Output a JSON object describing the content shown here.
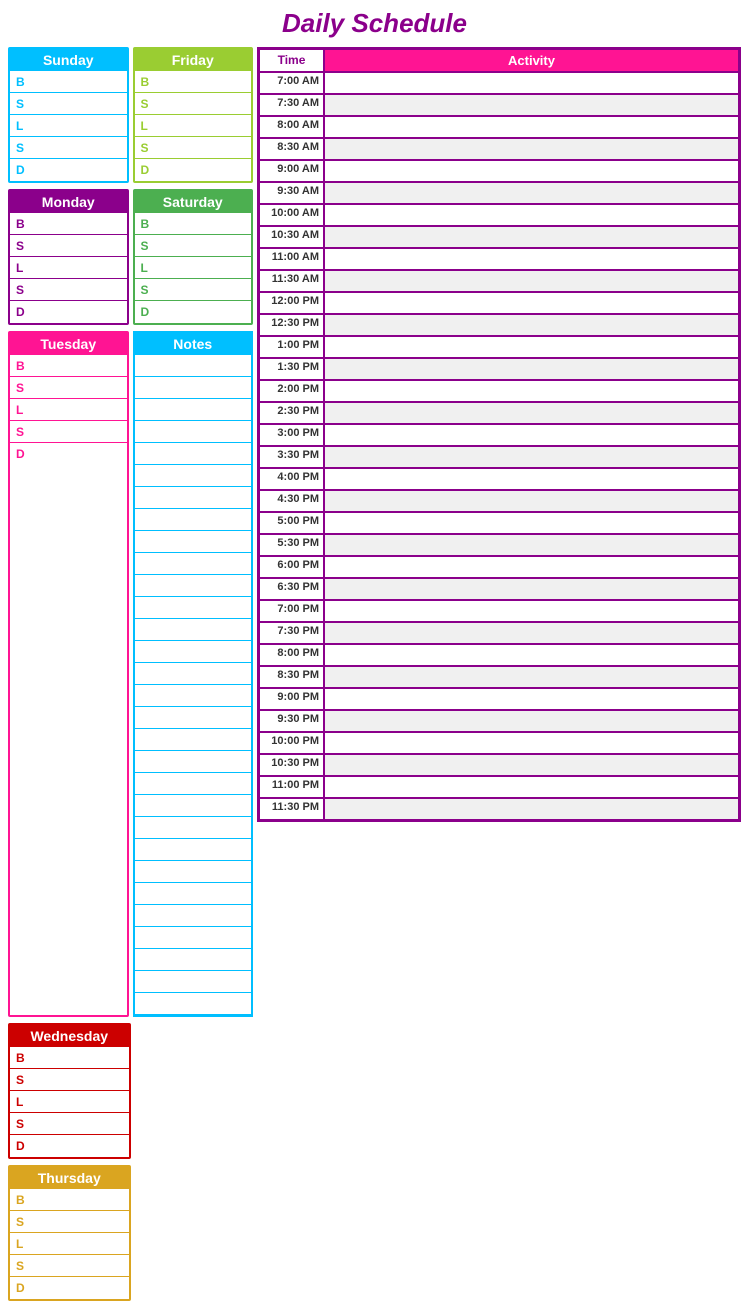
{
  "title": "Daily Schedule",
  "days": {
    "sunday": {
      "label": "Sunday",
      "class": "sunday",
      "meals": [
        "B",
        "S",
        "L",
        "S",
        "D"
      ]
    },
    "monday": {
      "label": "Monday",
      "class": "monday",
      "meals": [
        "B",
        "S",
        "L",
        "S",
        "D"
      ]
    },
    "tuesday": {
      "label": "Tuesday",
      "class": "tuesday",
      "meals": [
        "B",
        "S",
        "L",
        "S",
        "D"
      ]
    },
    "wednesday": {
      "label": "Wednesday",
      "class": "wednesday",
      "meals": [
        "B",
        "S",
        "L",
        "S",
        "D"
      ]
    },
    "thursday": {
      "label": "Thursday",
      "class": "thursday",
      "meals": [
        "B",
        "S",
        "L",
        "S",
        "D"
      ]
    },
    "friday": {
      "label": "Friday",
      "class": "friday",
      "meals": [
        "B",
        "S",
        "L",
        "S",
        "D"
      ]
    },
    "saturday": {
      "label": "Saturday",
      "class": "saturday",
      "meals": [
        "B",
        "S",
        "L",
        "S",
        "D"
      ]
    }
  },
  "notes_label": "Notes",
  "schedule_header": {
    "time": "Time",
    "activity": "Activity"
  },
  "times": [
    "7:00 AM",
    "7:30 AM",
    "8:00 AM",
    "8:30 AM",
    "9:00 AM",
    "9:30 AM",
    "10:00 AM",
    "10:30 AM",
    "11:00 AM",
    "11:30 AM",
    "12:00 PM",
    "12:30 PM",
    "1:00 PM",
    "1:30 PM",
    "2:00 PM",
    "2:30 PM",
    "3:00 PM",
    "3:30 PM",
    "4:00 PM",
    "4:30 PM",
    "5:00 PM",
    "5:30 PM",
    "6:00 PM",
    "6:30 PM",
    "7:00 PM",
    "7:30 PM",
    "8:00 PM",
    "8:30 PM",
    "9:00 PM",
    "9:30 PM",
    "10:00 PM",
    "10:30 PM",
    "11:00 PM",
    "11:30 PM"
  ]
}
